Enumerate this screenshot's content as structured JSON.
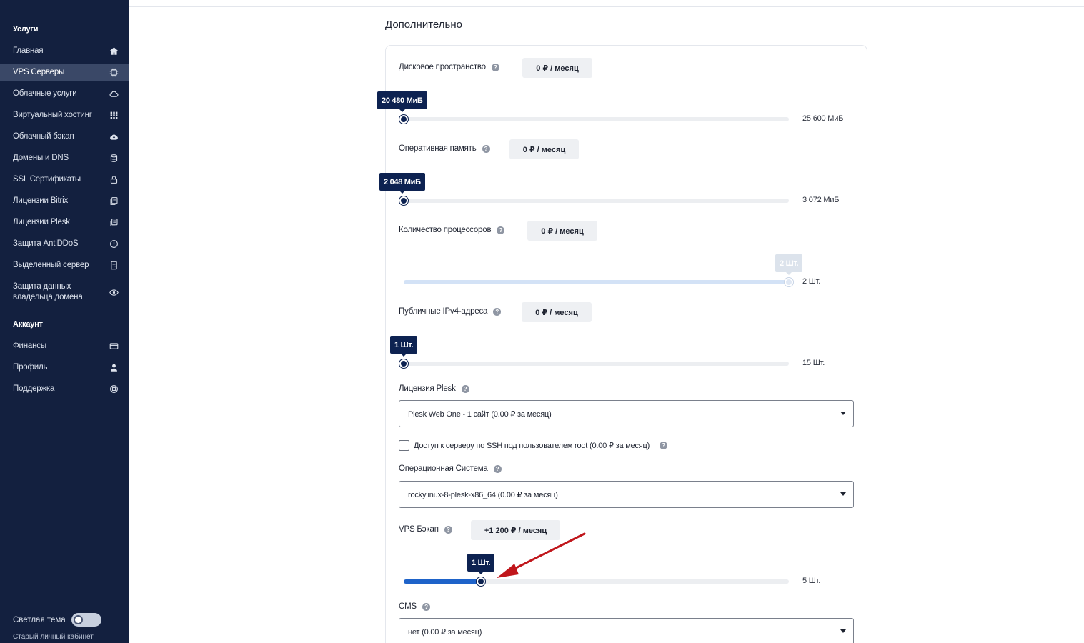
{
  "sidebar": {
    "services_heading": "Услуги",
    "items": [
      {
        "label": "Главная",
        "icon": "home-icon"
      },
      {
        "label": "VPS Серверы",
        "icon": "chip-icon",
        "active": true
      },
      {
        "label": "Облачные услуги",
        "icon": "cloud-icon"
      },
      {
        "label": "Виртуальный хостинг",
        "icon": "grid-icon"
      },
      {
        "label": "Облачный бэкап",
        "icon": "cloud-upload-icon"
      },
      {
        "label": "Домены и DNS",
        "icon": "database-icon"
      },
      {
        "label": "SSL Сертификаты",
        "icon": "lock-icon"
      },
      {
        "label": "Лицензии Bitrix",
        "icon": "license-icon"
      },
      {
        "label": "Лицензии Plesk",
        "icon": "license-icon"
      },
      {
        "label": "Защита AntiDDoS",
        "icon": "alert-circle-icon"
      },
      {
        "label": "Выделенный сервер",
        "icon": "server-icon"
      },
      {
        "label": "Защита данных владельца домена",
        "icon": "eye-icon"
      }
    ],
    "account_heading": "Аккаунт",
    "account_items": [
      {
        "label": "Финансы",
        "icon": "credit-card-icon"
      },
      {
        "label": "Профиль",
        "icon": "user-icon"
      },
      {
        "label": "Поддержка",
        "icon": "lifebuoy-icon"
      }
    ],
    "theme_label": "Светлая тема",
    "old_cabinet": "Старый личный кабинет"
  },
  "main": {
    "section_title": "Дополнительно",
    "disk": {
      "label": "Дисковое пространство",
      "price": "0 ₽  / месяц",
      "value": "20 480 МиБ",
      "max": "25 600 МиБ",
      "fraction": 0
    },
    "ram": {
      "label": "Оперативная память",
      "price": "0 ₽  / месяц",
      "value": "2 048 МиБ",
      "max": "3 072 МиБ",
      "fraction": 0
    },
    "cpu": {
      "label": "Количество процессоров",
      "price": "0 ₽  / месяц",
      "value": "2 Шт.",
      "max": "2 Шт.",
      "fraction": 1,
      "disabled": true
    },
    "ipv4": {
      "label": "Публичные IPv4-адреса",
      "price": "0 ₽  / месяц",
      "value": "1 Шт.",
      "max": "15 Шт.",
      "fraction": 0
    },
    "plesk": {
      "label": "Лицензия Plesk",
      "selected": "Plesk Web One - 1 сайт (0.00 ₽ за месяц)"
    },
    "ssh": {
      "label": "Доступ к серверу по SSH под пользователем root (0.00 ₽ за месяц)",
      "checked": false
    },
    "os": {
      "label": "Операционная Система",
      "selected": "rockylinux-8-plesk-x86_64 (0.00 ₽ за месяц)"
    },
    "backup": {
      "label": "VPS Бэкап",
      "price": "+1 200 ₽  / месяц",
      "value": "1 Шт.",
      "max": "5 Шт.",
      "fraction": 0.2
    },
    "cms": {
      "label": "CMS",
      "selected": "нет (0.00 ₽ за месяц)"
    }
  },
  "colors": {
    "sidebar_bg": "#13203f",
    "accent": "#1e63c9",
    "tooltip": "#0d2251",
    "annotation_arrow": "#c0161b"
  }
}
